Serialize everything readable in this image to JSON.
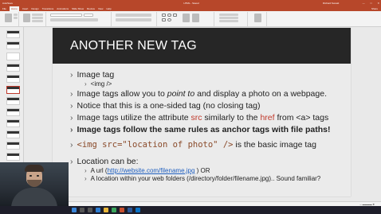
{
  "titlebar": {
    "autosave": "AutoSave",
    "doc_title": "HTML - Saved",
    "user": "Richard Sweatt"
  },
  "ribbon_tabs": [
    "File",
    "Home",
    "Insert",
    "Design",
    "Transitions",
    "Animations",
    "Slide Show",
    "Review",
    "View",
    "Help"
  ],
  "ribbon_share": "Share",
  "slide": {
    "title": "ANOTHER NEW TAG",
    "bullets": {
      "b1": "Image tag",
      "b1_sub": "<img />",
      "b2_a": "Image tags allow you to ",
      "b2_italic": "point to",
      "b2_b": " and display a photo on a webpage.",
      "b3": "Notice that this is a one-sided tag (no closing tag)",
      "b4_a": "Image tags utilize the attribute ",
      "b4_src": "src",
      "b4_b": " similarly to the ",
      "b4_href": "href",
      "b4_c": " from <a> tags",
      "b5": "Image tags follow the same rules as anchor tags with file paths!",
      "b6_code_a": "<img ",
      "b6_code_src": "src",
      "b6_code_b": "=\"location of photo\" />",
      "b6_rest": " is the basic image tag",
      "b7": "Location can be:",
      "b7_sub1_a": "A url (",
      "b7_sub1_link": "http://website.com/filename.jpg",
      "b7_sub1_b": " ) OR",
      "b7_sub2": "A location within your web folders (/directory/folder/filename.jpg).. Sound familiar?"
    }
  },
  "thumbnails": {
    "count": 12,
    "active_index": 6
  },
  "icons": {
    "window_controls": [
      "minimize-icon",
      "maximize-icon",
      "close-icon"
    ],
    "taskbar": [
      "windows-start-icon",
      "search-icon",
      "task-view-icon",
      "edge-icon",
      "file-explorer-icon",
      "chrome-icon",
      "powerpoint-icon",
      "word-icon",
      "mail-icon"
    ]
  },
  "colors": {
    "accent": "#b7472a",
    "title_band": "#262626",
    "slide_bg": "#ebebeb",
    "keyword_red": "#c0392b",
    "link_blue": "#1f5fbf"
  }
}
